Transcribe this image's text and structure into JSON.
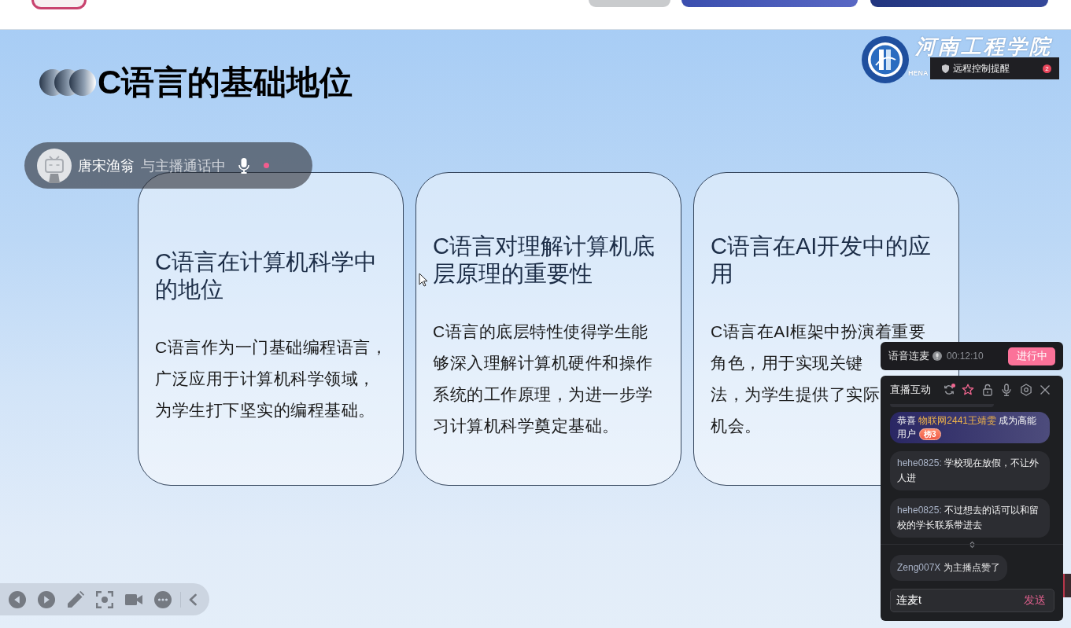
{
  "slide": {
    "title": "C语言的基础地位",
    "school": {
      "name": "河南工程学院",
      "name_en": "HENA"
    },
    "cards": [
      {
        "heading": "C语言在计算机科学中的地位",
        "lines": [
          "C语言作为一门基础编程语言，",
          "广泛应用于计算机科学领域，",
          "为学生打下坚实的编程基础。"
        ]
      },
      {
        "heading": "C语言对理解计算机底层原理的重要性",
        "lines": [
          "C语言的底层特性使得学生能",
          "够深入理解计算机硬件和操作",
          "系统的工作原理，为进一步学",
          "习计算机科学奠定基础。"
        ]
      },
      {
        "heading": "C语言在AI开发中的应用",
        "visible_lines": [
          "C语言在AI框架中扮演着重要",
          "角色，用于实现关键",
          "法，为学生提供了实际",
          "机会。"
        ]
      }
    ]
  },
  "call_banner": {
    "user": "唐宋渔翁",
    "status": "与主播通话中"
  },
  "remote_tip": {
    "text": "远程控制提醒",
    "count": "2"
  },
  "voice_link": {
    "label": "语音连麦",
    "timer": "00:12:10",
    "button": "进行中"
  },
  "live_panel": {
    "title": "直播互动",
    "tools": [
      {
        "kind": "sync",
        "on": false,
        "dot": true
      },
      {
        "kind": "effects",
        "on": true,
        "dot": false
      },
      {
        "kind": "lock",
        "on": false,
        "dot": false
      },
      {
        "kind": "mic",
        "on": false,
        "dot": false
      },
      {
        "kind": "settings",
        "on": false,
        "dot": false
      },
      {
        "kind": "close",
        "on": false,
        "dot": false
      }
    ],
    "messages": [
      {
        "kind": "highlight",
        "prefix": "恭喜",
        "user": "物联网2441王靖雯",
        "text": "成为高能用户",
        "badge": "榜3"
      },
      {
        "kind": "chat",
        "user": "hehe0825:",
        "text": "学校现在放假，不让外人进"
      },
      {
        "kind": "chat",
        "user": "hehe0825:",
        "text": "不过想去的话可以和留校的学长联系带进去"
      },
      {
        "kind": "like",
        "user": "Zeng007X",
        "text": "为主播点赞了"
      }
    ],
    "input": {
      "value": "连麦t"
    },
    "send": "发送"
  }
}
